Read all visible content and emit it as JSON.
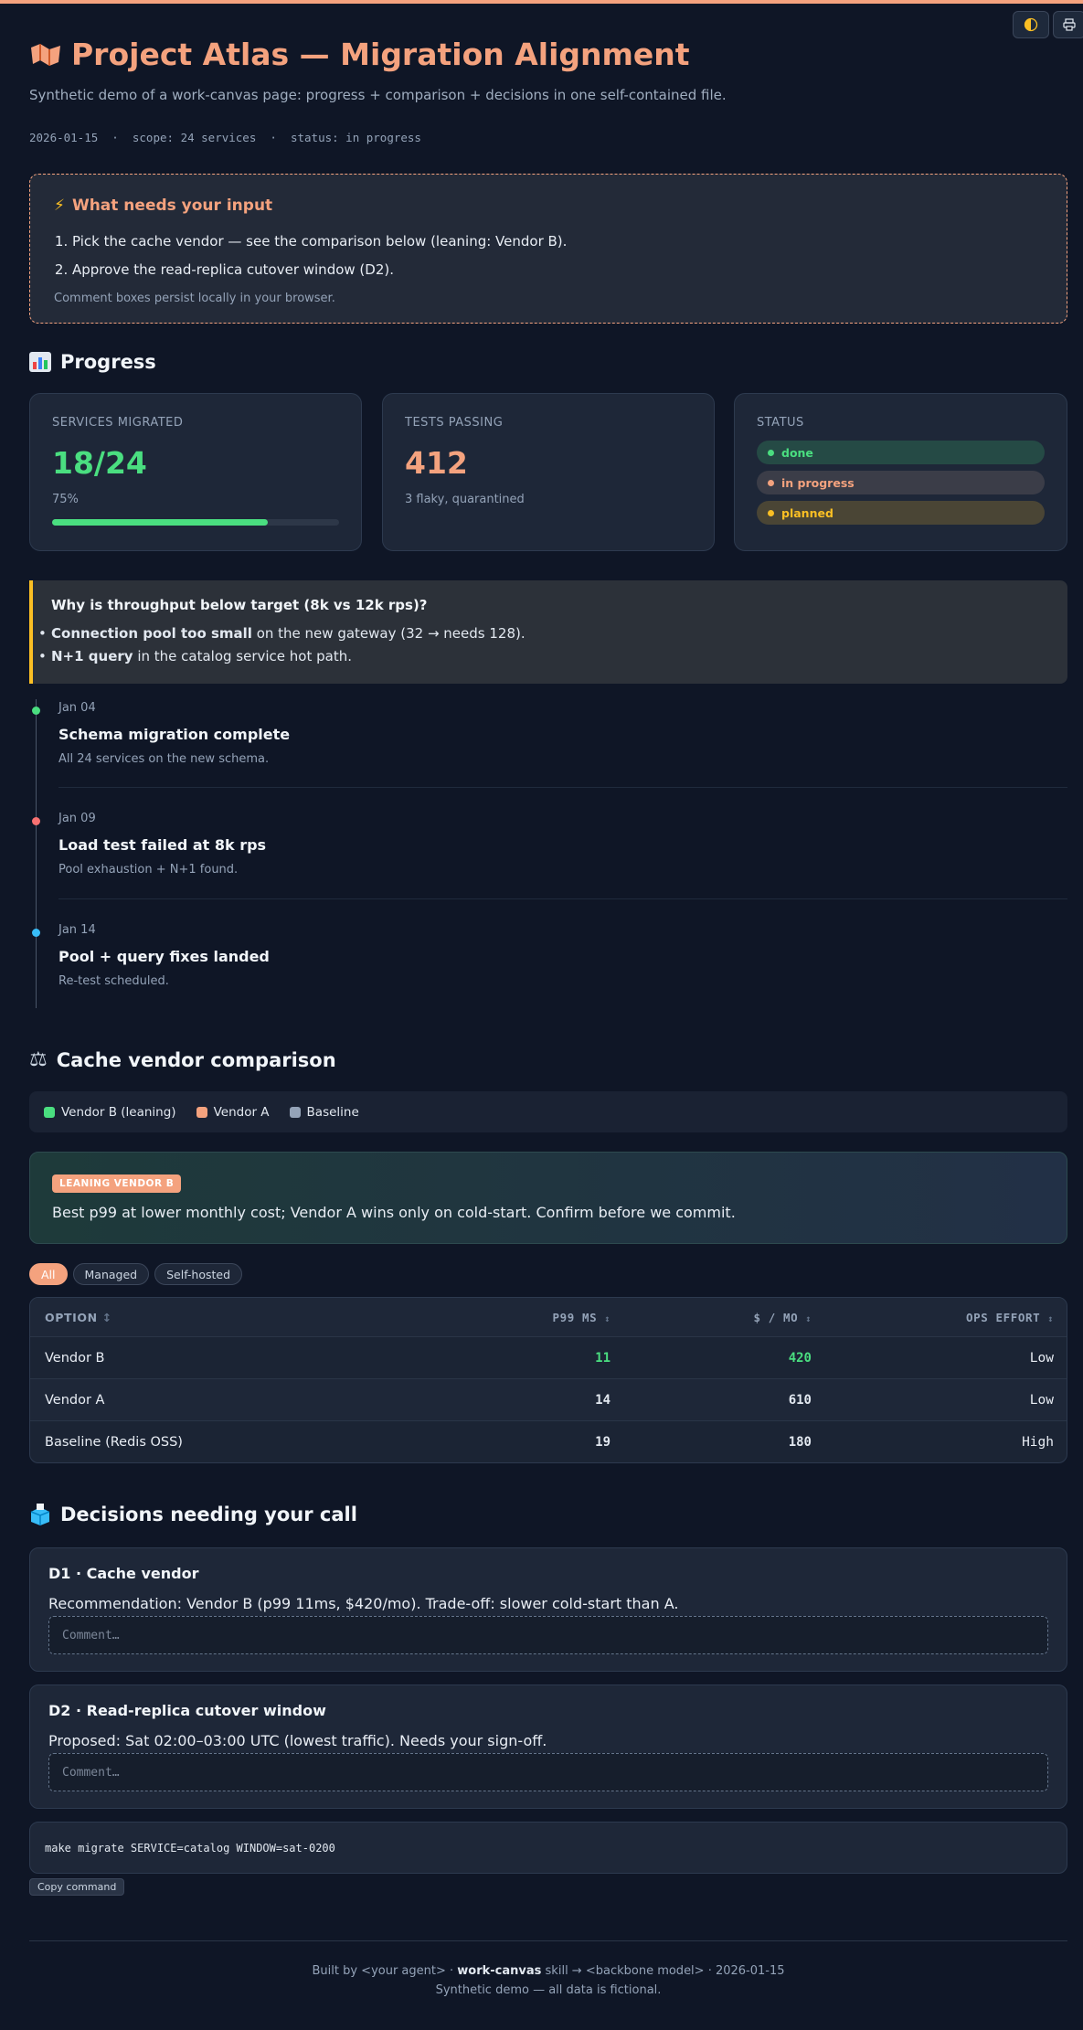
{
  "header": {
    "title": "Project Atlas — Migration Alignment",
    "subtitle": "Synthetic demo of a work-canvas page: progress + comparison + decisions in one self-contained file.",
    "meta": "2026-01-15  ·  scope: 24 services  ·  status: in progress",
    "theme_toggle_icon": "contrast-icon",
    "print_icon": "print-icon"
  },
  "input": {
    "title": "What needs your input",
    "items": [
      "Pick the cache vendor — see the comparison below (leaning: Vendor B).",
      "Approve the read-replica cutover window (D2)."
    ],
    "note": "Comment boxes persist locally in your browser."
  },
  "progress": {
    "heading": "Progress",
    "services": {
      "label": "SERVICES MIGRATED",
      "value": "18/24",
      "pct_label": "75%",
      "pct": 0.75
    },
    "tests": {
      "label": "TESTS PASSING",
      "value": "412",
      "sub": "3 flaky, quarantined"
    },
    "status": {
      "label": "STATUS",
      "pills": [
        {
          "label": "done",
          "color": "#4ade80"
        },
        {
          "label": "in progress",
          "color": "#f4a27e"
        },
        {
          "label": "planned",
          "color": "#fbbf24"
        }
      ]
    }
  },
  "why": {
    "title": "Why is throughput below target (8k vs 12k rps)?",
    "items": [
      {
        "bold": "Connection pool too small",
        "rest": " on the new gateway (32 → needs 128)."
      },
      {
        "bold": "N+1 query",
        "rest": " in the catalog service hot path."
      }
    ]
  },
  "timeline": [
    {
      "date": "Jan 04",
      "title": "Schema migration complete",
      "desc": "All 24 services on the new schema.",
      "color": "#4ade80"
    },
    {
      "date": "Jan 09",
      "title": "Load test failed at 8k rps",
      "desc": "Pool exhaustion + N+1 found.",
      "color": "#f87171"
    },
    {
      "date": "Jan 14",
      "title": "Pool + query fixes landed",
      "desc": "Re-test scheduled.",
      "color": "#38bdf8"
    }
  ],
  "comparison": {
    "heading": "Cache vendor comparison",
    "legend": [
      {
        "label": "Vendor B (leaning)",
        "color": "#4ade80"
      },
      {
        "label": "Vendor A",
        "color": "#f4a27e"
      },
      {
        "label": "Baseline",
        "color": "#94a3b8"
      }
    ],
    "lean_badge": "LEANING VENDOR B",
    "lean_text": "Best p99 at lower monthly cost; Vendor A wins only on cold-start. Confirm before we commit.",
    "filters": [
      "All",
      "Managed",
      "Self-hosted"
    ],
    "columns": [
      "OPTION",
      "P99 MS",
      "$ / MO",
      "OPS EFFORT"
    ],
    "sort_icon": "↕",
    "rows": [
      {
        "option": "Vendor B",
        "p99": "11",
        "cost": "420",
        "effort": "Low"
      },
      {
        "option": "Vendor A",
        "p99": "14",
        "cost": "610",
        "effort": "Low"
      },
      {
        "option": "Baseline (Redis OSS)",
        "p99": "19",
        "cost": "180",
        "effort": "High"
      }
    ]
  },
  "decisions": {
    "heading": "Decisions needing your call",
    "items": [
      {
        "title": "D1 · Cache vendor",
        "text": "Recommendation: Vendor B (p99 11ms, $420/mo). Trade-off: slower cold-start than A.",
        "placeholder": "Comment…"
      },
      {
        "title": "D2 · Read-replica cutover window",
        "text": "Proposed: Sat 02:00–03:00 UTC (lowest traffic). Needs your sign-off.",
        "placeholder": "Comment…"
      }
    ]
  },
  "command": {
    "text": "make migrate SERVICE=catalog WINDOW=sat-0200",
    "copy_label": "Copy command"
  },
  "footer": {
    "line1_pre": "Built by <your agent> · ",
    "line1_bold": "work-canvas",
    "line1_post": " skill → <backbone model> · 2026-01-15",
    "line2": "Synthetic demo — all data is fictional."
  }
}
